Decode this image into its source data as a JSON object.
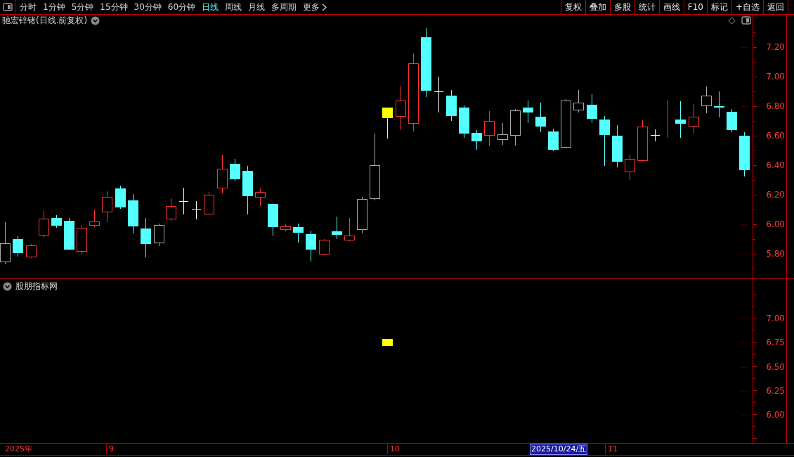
{
  "toolbar": {
    "periods": [
      {
        "label": "分时",
        "selected": false
      },
      {
        "label": "1分钟",
        "selected": false
      },
      {
        "label": "5分钟",
        "selected": false
      },
      {
        "label": "15分钟",
        "selected": false
      },
      {
        "label": "30分钟",
        "selected": false
      },
      {
        "label": "60分钟",
        "selected": false
      },
      {
        "label": "日线",
        "selected": true
      },
      {
        "label": "周线",
        "selected": false
      },
      {
        "label": "月线",
        "selected": false
      },
      {
        "label": "多周期",
        "selected": false
      },
      {
        "label": "更多",
        "selected": false
      }
    ],
    "actions": [
      "复权",
      "叠加",
      "多股",
      "统计",
      "画线",
      "F10",
      "标记",
      "+自选",
      "返回"
    ]
  },
  "main_panel": {
    "title": "驰宏锌锗(日线.前复权)",
    "y_axis": [
      "7.20",
      "7.00",
      "6.80",
      "6.60",
      "6.40",
      "6.20",
      "6.00",
      "5.80"
    ]
  },
  "indicator_panel": {
    "title": "股朋指标网",
    "y_axis": [
      "7.00",
      "6.75",
      "6.50",
      "6.25",
      "6.00"
    ]
  },
  "date_bar": {
    "labels": [
      "2025年",
      "9",
      "10",
      "11"
    ],
    "cursor_date": "2025/10/24/五"
  }
}
